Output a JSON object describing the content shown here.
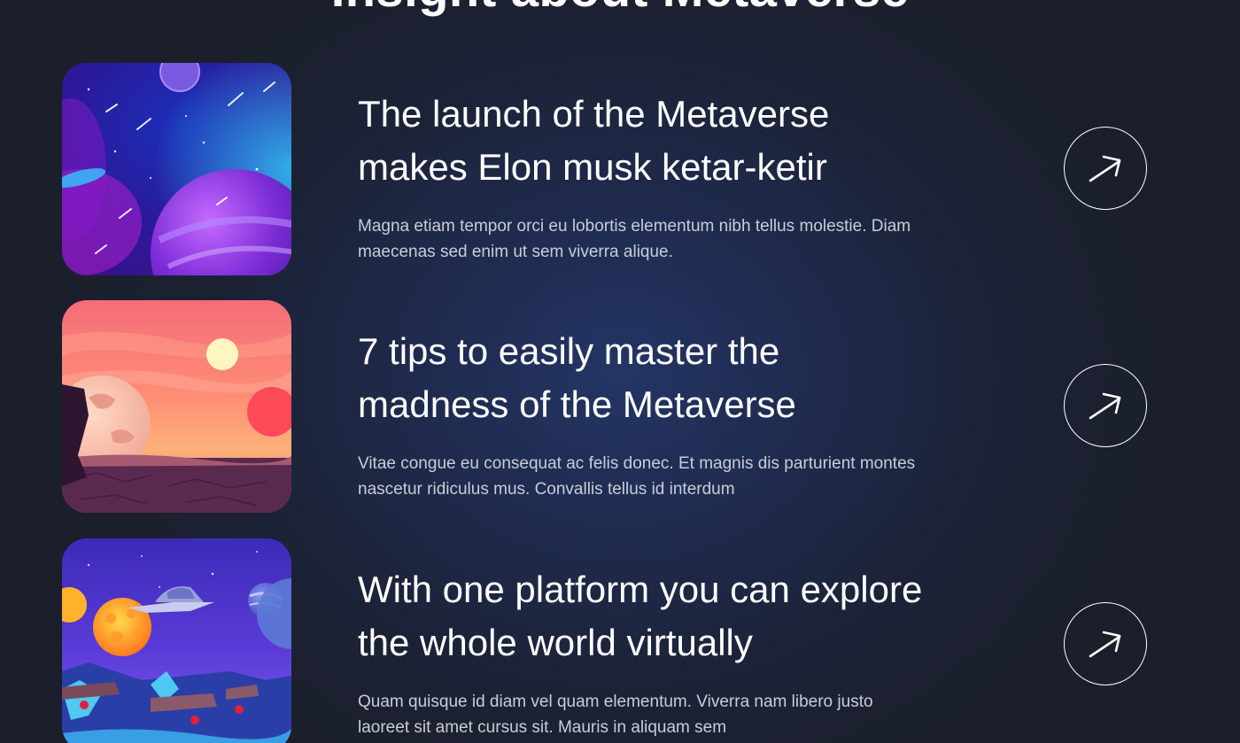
{
  "section": {
    "heading": "Insight about Metaverse"
  },
  "articles": [
    {
      "title": "The launch of the Metaverse makes Elon musk ketar-ketir",
      "description": "Magna etiam tempor orci eu lobortis elementum nibh tellus molestie. Diam maecenas sed enim ut sem viverra alique.",
      "thumbnail": "space-planets-illustration",
      "action_icon": "arrow-up-right-icon"
    },
    {
      "title": "7 tips to easily master the madness of the Metaverse",
      "description": "Vitae congue eu consequat ac felis donec. Et magnis dis parturient montes nascetur ridiculus mus. Convallis tellus id interdum",
      "thumbnail": "alien-sunset-landscape-illustration",
      "action_icon": "arrow-up-right-icon"
    },
    {
      "title": "With one platform you can explore the whole world virtually",
      "description": "Quam quisque id diam vel quam elementum. Viverra nam libero justo laoreet sit amet cursus sit. Mauris in aliquam sem",
      "thumbnail": "spaceship-floating-islands-illustration",
      "action_icon": "arrow-up-right-icon"
    }
  ]
}
